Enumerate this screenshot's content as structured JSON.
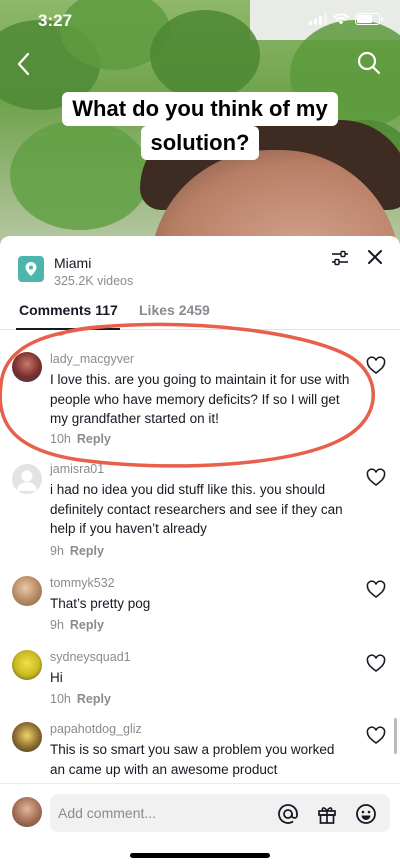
{
  "status_bar": {
    "time": "3:27"
  },
  "video": {
    "caption_line1": "What do you think of my",
    "caption_line2": "solution?"
  },
  "sheet": {
    "location_title": "Miami",
    "location_subtitle": "325.2K videos",
    "tabs": {
      "comments": "Comments 117",
      "likes": "Likes 2459"
    }
  },
  "comments": [
    {
      "user": "lady_macgyver",
      "text": "I love this. are you going to maintain it for use with people who have memory deficits? If so I will get my grandfather started on it!",
      "time": "10h",
      "reply": "Reply"
    },
    {
      "user": "jamisra01",
      "text": "i had no idea you did stuff like this. you should definitely contact researchers and see if they can help if you haven’t already",
      "time": "9h",
      "reply": "Reply"
    },
    {
      "user": "tommyk532",
      "text": "That’s pretty pog",
      "time": "9h",
      "reply": "Reply"
    },
    {
      "user": "sydneysquad1",
      "text": "Hi",
      "time": "10h",
      "reply": "Reply"
    },
    {
      "user": "papahotdog_gliz",
      "text": "This is so smart you saw a problem you worked an came up with an awesome product",
      "time": "",
      "reply": ""
    }
  ],
  "input": {
    "placeholder": "Add comment..."
  },
  "colors": {
    "annotation": "#e8604c",
    "location_icon": "#4db6ac"
  },
  "icons": [
    "back-icon",
    "search-icon",
    "location-pin-icon",
    "filter-icon",
    "close-icon",
    "heart-icon",
    "at-icon",
    "gift-icon",
    "emoji-icon"
  ]
}
